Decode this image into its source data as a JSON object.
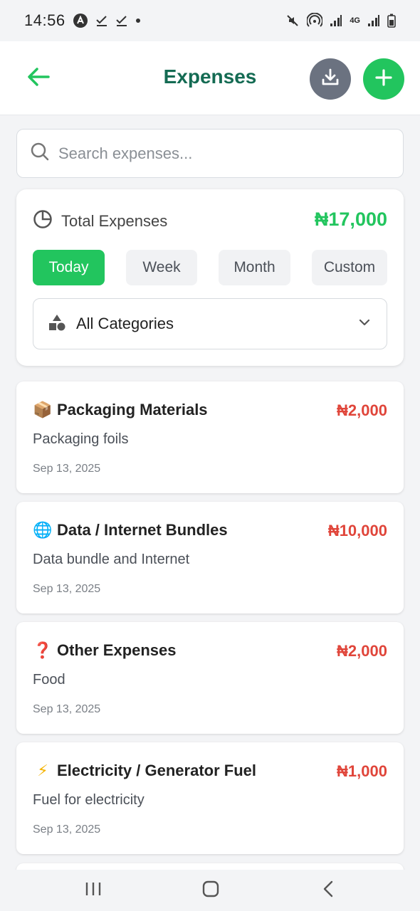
{
  "status_bar": {
    "time": "14:56",
    "left_icons": [
      "app-notification-icon",
      "check-icon",
      "check-icon",
      "dot-icon"
    ],
    "right_icons": [
      "mute-icon",
      "hotspot-icon",
      "signal-icon",
      "4g-icon",
      "signal-icon",
      "battery-icon"
    ],
    "network_label": "4G"
  },
  "header": {
    "title": "Expenses",
    "back_icon": "arrow-left-icon",
    "download_icon": "download-icon",
    "add_icon": "plus-icon"
  },
  "search": {
    "placeholder": "Search expenses...",
    "value": ""
  },
  "summary": {
    "label": "Total Expenses",
    "total": "₦17,000",
    "periods": [
      "Today",
      "Week",
      "Month",
      "Custom"
    ],
    "active_period": "Today",
    "category_filter": "All Categories"
  },
  "expenses": [
    {
      "emoji": "📦",
      "title": "Packaging Materials",
      "amount": "₦2,000",
      "description": "Packaging foils",
      "date": "Sep 13, 2025"
    },
    {
      "emoji": "🌐",
      "title": "Data / Internet Bundles",
      "amount": "₦10,000",
      "description": "Data bundle and Internet",
      "date": "Sep 13, 2025"
    },
    {
      "emoji": "❓",
      "title": "Other Expenses",
      "amount": "₦2,000",
      "description": "Food",
      "date": "Sep 13, 2025"
    },
    {
      "emoji": "⚡",
      "title": "Electricity / Generator Fuel",
      "amount": "₦1,000",
      "description": "Fuel for electricity",
      "date": "Sep 13, 2025"
    }
  ],
  "colors": {
    "accent_green": "#22c55e",
    "title_green": "#146b53",
    "amount_red": "#e0453a",
    "download_gray": "#6b7280"
  }
}
